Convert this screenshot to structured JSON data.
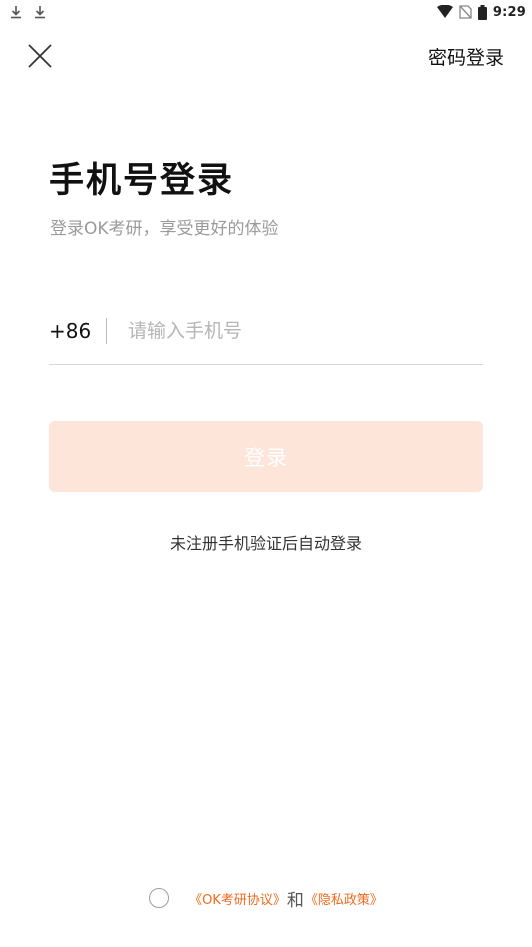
{
  "status_bar": {
    "time": "9:29",
    "icons": [
      "download-icon",
      "download-icon",
      "wifi-icon",
      "no-sim-icon",
      "battery-icon"
    ]
  },
  "header": {
    "close_icon": "close-icon",
    "password_login_label": "密码登录"
  },
  "title": "手机号登录",
  "subtitle": "登录OK考研，享受更好的体验",
  "phone": {
    "country_code": "+86",
    "placeholder": "请输入手机号",
    "value": ""
  },
  "login_button": {
    "label": "登录",
    "background": "#fde5da"
  },
  "hint": "未注册手机验证后自动登录",
  "agreement": {
    "checked": false,
    "agreement_link": "《OK考研协议》",
    "and_text": "和",
    "privacy_link": "《隐私政策》",
    "link_color": "#f06a1c"
  }
}
